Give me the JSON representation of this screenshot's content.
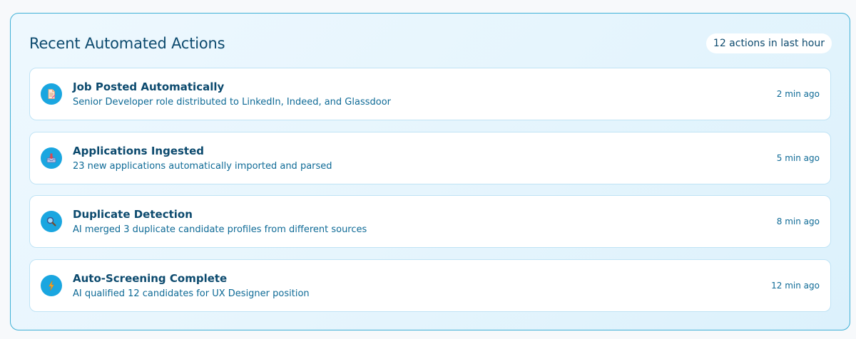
{
  "panel": {
    "title": "Recent Automated Actions",
    "count_badge": "12 actions in last hour"
  },
  "actions": [
    {
      "icon": "document-icon",
      "title": "Job Posted Automatically",
      "description": "Senior Developer role distributed to LinkedIn, Indeed, and Glassdoor",
      "time": "2 min ago"
    },
    {
      "icon": "inbox-tray-icon",
      "title": "Applications Ingested",
      "description": "23 new applications automatically imported and parsed",
      "time": "5 min ago"
    },
    {
      "icon": "magnifier-icon",
      "title": "Duplicate Detection",
      "description": "AI merged 3 duplicate candidate profiles from different sources",
      "time": "8 min ago"
    },
    {
      "icon": "lightning-icon",
      "title": "Auto-Screening Complete",
      "description": "AI qualified 12 candidates for UX Designer position",
      "time": "12 min ago"
    }
  ],
  "colors": {
    "accent": "#1aa6e0",
    "title": "#0c4a6e",
    "text": "#0e6a96",
    "border": "#3fb0d6"
  }
}
